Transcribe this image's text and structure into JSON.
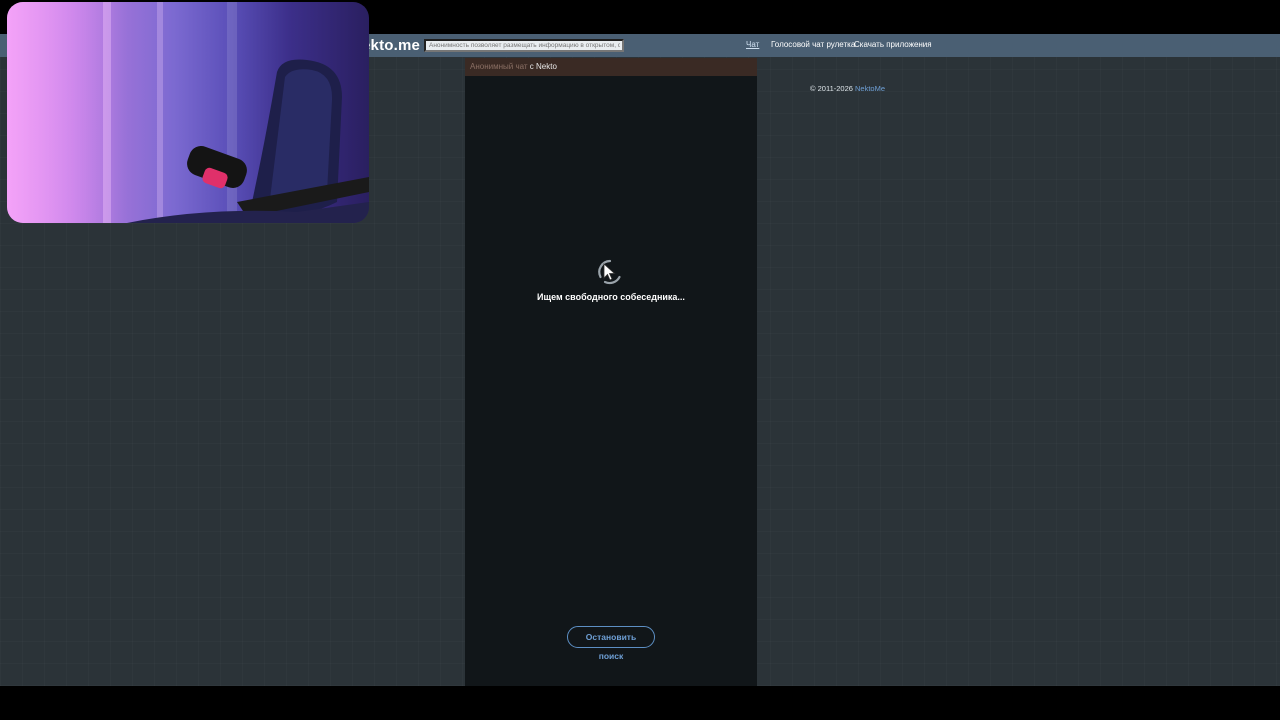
{
  "header": {
    "logo": "ekto.me",
    "notice_placeholder": "Анонимность позволяет размещать информацию в открытом, сырой вид!",
    "nav": [
      "Чат",
      "Голосовой чат рулетка",
      "Скачать приложения"
    ]
  },
  "chat": {
    "header_prefix": "Анонимный чат",
    "header_suffix": "с Nekto",
    "status": "Ищем свободного собеседника...",
    "stop_button": "Остановить поиск"
  },
  "footer": {
    "copyright": "© 2011-2026",
    "brand_link": "NektoMe"
  },
  "icons": [
    "spinner-icon",
    "cursor-icon"
  ],
  "colors": {
    "topbar": "#4a5f73",
    "background": "#2b3338",
    "chat_panel": "#111619",
    "chat_header": "#3a2a24",
    "accent": "#5d8fc4"
  }
}
